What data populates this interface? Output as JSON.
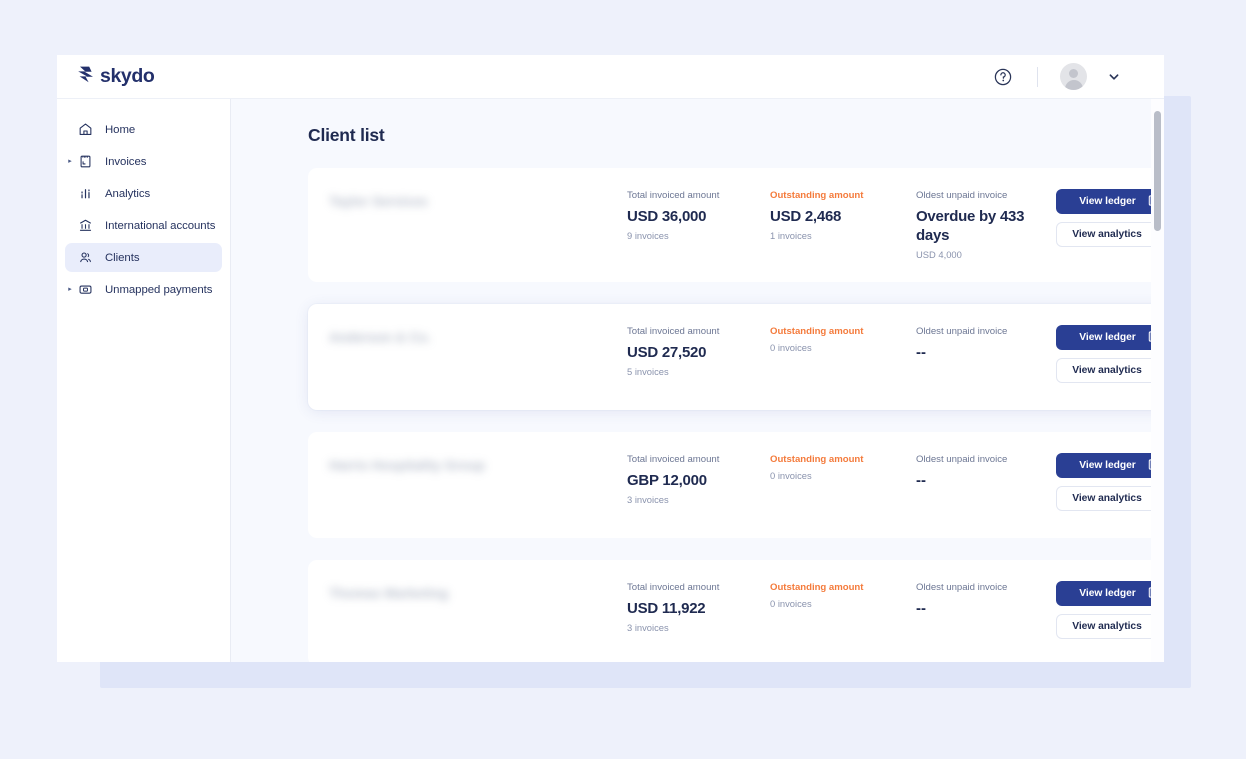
{
  "brand": {
    "name": "skydo",
    "logo_icon": "skydo-logo-icon"
  },
  "topbar": {
    "help_icon": "question-circle-icon",
    "avatar_icon": "user-avatar-icon",
    "chevron_icon": "chevron-down-icon"
  },
  "sidebar": {
    "items": [
      {
        "label": "Home",
        "icon": "home-icon",
        "active": false,
        "expandable": false
      },
      {
        "label": "Invoices",
        "icon": "invoice-document-icon",
        "active": false,
        "expandable": true
      },
      {
        "label": "Analytics",
        "icon": "bar-chart-icon",
        "active": false,
        "expandable": false
      },
      {
        "label": "International accounts",
        "icon": "bank-icon",
        "active": false,
        "expandable": false
      },
      {
        "label": "Clients",
        "icon": "people-icon",
        "active": true,
        "expandable": false
      },
      {
        "label": "Unmapped payments",
        "icon": "payment-card-icon",
        "active": false,
        "expandable": true
      }
    ]
  },
  "main": {
    "page_title": "Client list",
    "column_labels": {
      "total": "Total invoiced amount",
      "outstanding": "Outstanding amount",
      "oldest": "Oldest unpaid invoice"
    },
    "buttons": {
      "view_ledger": "View ledger",
      "view_ledger_icon": "ledger-book-icon",
      "view_analytics": "View analytics",
      "view_analytics_icon": "trend-arrow-icon"
    },
    "colors": {
      "primary": "#2a3f94",
      "warning": "#f47b3c",
      "text_dark": "#1f2a50",
      "text_muted": "#6d7794",
      "page_bg": "#f7f9fe",
      "active_nav_bg": "#e9edfb"
    },
    "cards": [
      {
        "name_redacted": "Taylor Services",
        "total_amount": "USD 36,000",
        "total_invoices": "9 invoices",
        "outstanding_amount": "USD 2,468",
        "outstanding_invoices": "1 invoices",
        "oldest_unpaid": "Overdue by 433 days",
        "oldest_unpaid_amount": "USD 4,000",
        "elevated": false
      },
      {
        "name_redacted": "Anderson & Co.",
        "total_amount": "USD 27,520",
        "total_invoices": "5 invoices",
        "outstanding_amount": "",
        "outstanding_invoices": "0 invoices",
        "oldest_unpaid": "--",
        "oldest_unpaid_amount": "",
        "elevated": true
      },
      {
        "name_redacted": "Harris Hospitality Group",
        "total_amount": "GBP 12,000",
        "total_invoices": "3 invoices",
        "outstanding_amount": "",
        "outstanding_invoices": "0 invoices",
        "oldest_unpaid": "--",
        "oldest_unpaid_amount": "",
        "elevated": false
      },
      {
        "name_redacted": "Thomas Marketing",
        "total_amount": "USD 11,922",
        "total_invoices": "3 invoices",
        "outstanding_amount": "",
        "outstanding_invoices": "0 invoices",
        "oldest_unpaid": "--",
        "oldest_unpaid_amount": "",
        "elevated": false
      }
    ]
  }
}
